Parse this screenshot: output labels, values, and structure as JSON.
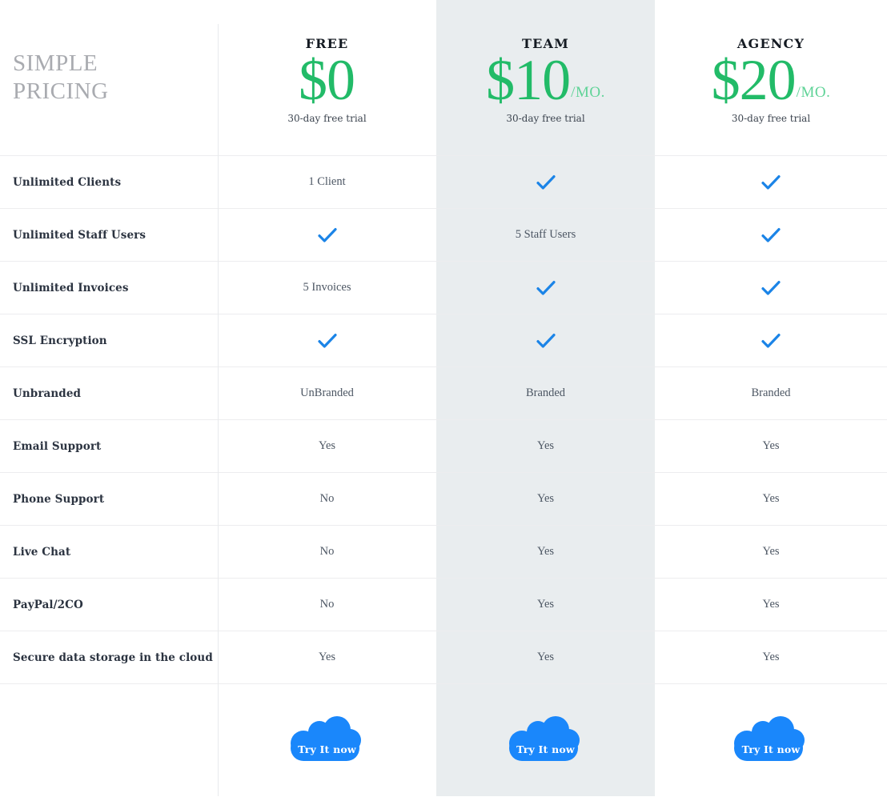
{
  "brand": {
    "title": "SIMPLE\nPRICING"
  },
  "colors": {
    "price_green": "#22bb68",
    "period_green": "#5fd397",
    "check_blue": "#1b84e7",
    "cloud_blue": "#1a87fb",
    "highlight_bg": "#e9edef",
    "rule": "#ededef",
    "label_text": "#2b3340",
    "value_text": "#4c5663",
    "brand_text": "#a9abb0"
  },
  "plans": [
    {
      "name": "FREE",
      "price": "$0",
      "period": "",
      "trial": "30-day free trial",
      "highlighted": false,
      "cta": "Try It now"
    },
    {
      "name": "TEAM",
      "price": "$10",
      "period": "/MO.",
      "trial": "30-day free trial",
      "highlighted": true,
      "cta": "Try It now"
    },
    {
      "name": "AGENCY",
      "price": "$20",
      "period": "/MO.",
      "trial": "30-day free trial",
      "highlighted": false,
      "cta": "Try It now"
    }
  ],
  "features": [
    {
      "label": "Unlimited Clients",
      "values": [
        "1 Client",
        "check",
        "check"
      ]
    },
    {
      "label": "Unlimited Staff Users",
      "values": [
        "check",
        "5 Staff Users",
        "check"
      ]
    },
    {
      "label": "Unlimited Invoices",
      "values": [
        "5 Invoices",
        "check",
        "check"
      ]
    },
    {
      "label": "SSL Encryption",
      "values": [
        "check",
        "check",
        "check"
      ]
    },
    {
      "label": "Unbranded",
      "values": [
        "UnBranded",
        "Branded",
        "Branded"
      ]
    },
    {
      "label": "Email Support",
      "values": [
        "Yes",
        "Yes",
        "Yes"
      ]
    },
    {
      "label": "Phone Support",
      "values": [
        "No",
        "Yes",
        "Yes"
      ]
    },
    {
      "label": "Live Chat",
      "values": [
        "No",
        "Yes",
        "Yes"
      ]
    },
    {
      "label": "PayPal/2CO",
      "values": [
        "No",
        "Yes",
        "Yes"
      ]
    },
    {
      "label": "Secure data storage in the cloud",
      "values": [
        "Yes",
        "Yes",
        "Yes"
      ]
    }
  ],
  "icons": {
    "check": "check-icon",
    "cloud": "cloud-shape-icon"
  }
}
